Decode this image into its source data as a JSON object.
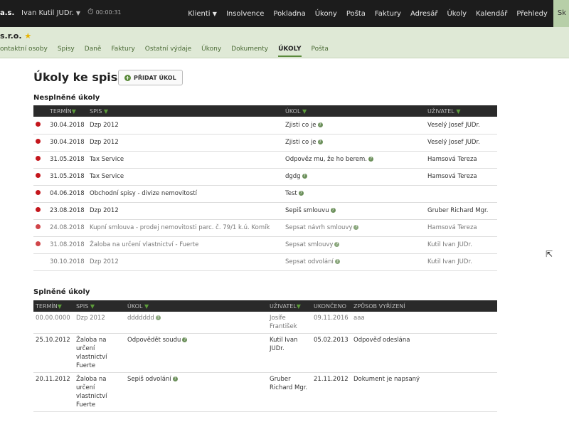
{
  "topbar": {
    "brand": "a.s.",
    "user": "Ivan Kutil JUDr.",
    "timer_icon": "stopwatch-icon",
    "timer": "00:00:31",
    "nav": [
      "Klienti",
      "Insolvence",
      "Pokladna",
      "Úkony",
      "Pošta",
      "Faktury",
      "Adresář",
      "Úkoly",
      "Kalendář",
      "Přehledy",
      "Sk"
    ]
  },
  "subbar": {
    "company": "s.r.o.",
    "tabs": [
      "ontaktní osoby",
      "Spisy",
      "Daně",
      "Faktury",
      "Ostatní výdaje",
      "Úkony",
      "Dokumenty",
      "ÚKOLY",
      "Pošta"
    ],
    "active_tab": "ÚKOLY"
  },
  "page": {
    "title": "Úkoly ke spisu",
    "add_button": "PŘIDAT ÚKOL"
  },
  "pending": {
    "title": "Nesplněné úkoly",
    "columns": [
      "TERMÍN",
      "SPIS",
      "ÚKOL",
      "UŽIVATEL"
    ],
    "rows": [
      {
        "dot": true,
        "date": "30.04.2018",
        "file": "Dzp 2012",
        "task": "Zjisti co je",
        "user": "Veselý Josef JUDr."
      },
      {
        "dot": true,
        "date": "30.04.2018",
        "file": "Dzp 2012",
        "task": "Zjisti co je",
        "user": "Veselý Josef JUDr."
      },
      {
        "dot": true,
        "date": "31.05.2018",
        "file": "Tax Service",
        "task": "Odpověz mu, že ho berem.",
        "user": "Hamsová Tereza"
      },
      {
        "dot": true,
        "date": "31.05.2018",
        "file": "Tax Service",
        "task": "dgdg",
        "user": "Hamsová Tereza"
      },
      {
        "dot": true,
        "date": "04.06.2018",
        "file": "Obchodní spisy - divize nemovitostí",
        "task": "Test",
        "user": ""
      },
      {
        "dot": true,
        "date": "23.08.2018",
        "file": "Dzp 2012",
        "task": "Sepiš smlouvu",
        "user": "Gruber Richard Mgr."
      },
      {
        "dot": true,
        "date": "24.08.2018",
        "file": "Kupní smlouva - prodej nemovitosti parc. č. 79/1 k.ú. Komík",
        "task": "Sepsat návrh smlouvy",
        "user": "Hamsová Tereza"
      },
      {
        "dot": true,
        "date": "31.08.2018",
        "file": "Žaloba na určení vlastnictví - Fuerte",
        "task": "Sepsat smlouvy",
        "user": "Kutil Ivan JUDr."
      },
      {
        "dot": false,
        "date": "30.10.2018",
        "file": "Dzp 2012",
        "task": "Sepsat odvolání",
        "user": "Kutil Ivan JUDr."
      }
    ]
  },
  "done": {
    "title": "Splněné úkoly",
    "columns": [
      "TERMÍN",
      "SPIS",
      "ÚKOL",
      "UŽIVATEL",
      "UKONČENO",
      "ZPŮSOB VYŘÍZENÍ"
    ],
    "rows": [
      {
        "date": "00.00.0000",
        "file": "Dzp 2012",
        "task": "ddddddd",
        "user": "Josífe František",
        "ended": "09.11.2016",
        "how": "aaa"
      },
      {
        "date": "25.10.2012",
        "file": "Žaloba na určení vlastnictví Fuerte",
        "task": "Odpovědět soudu",
        "user": "Kutil Ivan JUDr.",
        "ended": "05.02.2013",
        "how": "Odpověď odeslána"
      },
      {
        "date": "20.11.2012",
        "file": "Žaloba na určení vlastnictví Fuerte",
        "task": "Sepiš odvolání",
        "user": "Gruber Richard Mgr.",
        "ended": "21.11.2012",
        "how": "Dokument je napsaný"
      }
    ]
  },
  "colors": {
    "topbar": "#1c1c1c",
    "subbar": "#dfe9d6",
    "accent": "#5b8a3c",
    "overdue": "#c4161c"
  }
}
